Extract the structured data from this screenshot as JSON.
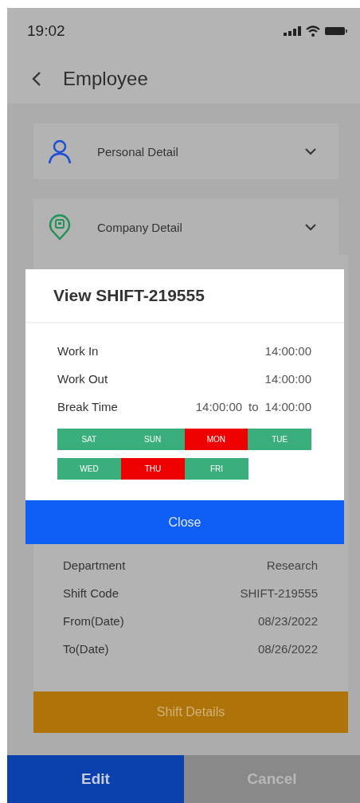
{
  "status_bar": {
    "time": "19:02"
  },
  "header": {
    "title": "Employee"
  },
  "sections": [
    {
      "kind": "person",
      "label": "Personal Detail",
      "expanded": false
    },
    {
      "kind": "company",
      "label": "Company Detail",
      "expanded": false
    }
  ],
  "details": [
    {
      "label": "Department",
      "value": "Research"
    },
    {
      "label": "Shift Code",
      "value": "SHIFT-219555"
    },
    {
      "label": "From(Date)",
      "value": "08/23/2022"
    },
    {
      "label": "To(Date)",
      "value": "08/26/2022"
    }
  ],
  "shift_details_button": "Shift Details",
  "footer": {
    "edit": "Edit",
    "cancel": "Cancel"
  },
  "modal": {
    "title": "View SHIFT-219555",
    "rows": [
      {
        "label": "Work In",
        "value": "14:00:00"
      },
      {
        "label": "Work Out",
        "value": "14:00:00"
      }
    ],
    "break": {
      "label": "Break Time",
      "from": "14:00:00",
      "joiner": "to",
      "to": "14:00:00"
    },
    "days": [
      [
        {
          "label": "SAT",
          "color": "#3aaf7b"
        },
        {
          "label": "SUN",
          "color": "#3aaf7b"
        },
        {
          "label": "MON",
          "color": "#ee0000"
        },
        {
          "label": "TUE",
          "color": "#3aaf7b"
        }
      ],
      [
        {
          "label": "WED",
          "color": "#3aaf7b"
        },
        {
          "label": "THU",
          "color": "#ee0000"
        },
        {
          "label": "FRI",
          "color": "#3aaf7b"
        }
      ]
    ],
    "close": "Close"
  }
}
